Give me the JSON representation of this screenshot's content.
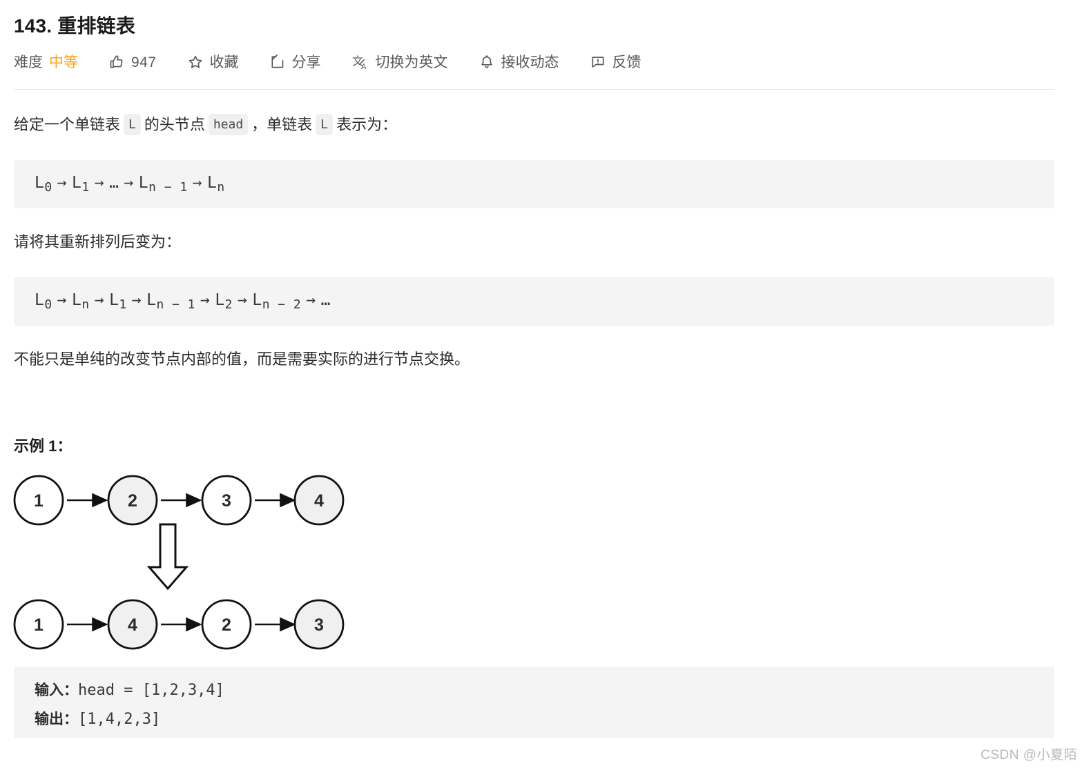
{
  "header": {
    "title": "143. 重排链表",
    "toolbar": {
      "difficulty_label": "难度",
      "difficulty_value": "中等",
      "difficulty_color": "#ffa116",
      "like_count": "947",
      "favorite_label": "收藏",
      "share_label": "分享",
      "translate_label": "切换为英文",
      "subscribe_label": "接收动态",
      "feedback_label": "反馈",
      "icons": {
        "like": "thumbs-up-icon",
        "favorite": "star-icon",
        "share": "share-box-icon",
        "translate": "translate-icon",
        "subscribe": "bell-icon",
        "feedback": "speech-bubble-alert-icon"
      }
    }
  },
  "content": {
    "paragraph_1": {
      "part_a": "给定一个单链表",
      "code_1": "L",
      "part_b": "的头节点",
      "code_2": "head",
      "part_c": "，单链表",
      "code_3": "L",
      "part_d": "表示为："
    },
    "formula_1": {
      "terms": [
        "L0",
        "Ln",
        "…",
        "Ln − 1",
        "Ln"
      ],
      "plain": "L0 → L1 → … → Ln − 1 → Ln"
    },
    "paragraph_2": "请将其重新排列后变为：",
    "formula_2": {
      "plain": "L0 → Ln → L1 → Ln − 1 → L2 → Ln − 2 → …"
    },
    "paragraph_3": "不能只是单纯的改变节点内部的值，而是需要实际的进行节点交换。",
    "example_heading": "示例 1："
  },
  "diagram": {
    "row_top": [
      {
        "value": "1",
        "fill": "#ffffff"
      },
      {
        "value": "2",
        "fill": "#f0f0f0"
      },
      {
        "value": "3",
        "fill": "#ffffff"
      },
      {
        "value": "4",
        "fill": "#f0f0f0"
      }
    ],
    "row_bottom": [
      {
        "value": "1",
        "fill": "#ffffff"
      },
      {
        "value": "4",
        "fill": "#f0f0f0"
      },
      {
        "value": "2",
        "fill": "#ffffff"
      },
      {
        "value": "3",
        "fill": "#f0f0f0"
      }
    ],
    "transform_arrow": "down-block-arrow-icon"
  },
  "example_io": {
    "input_label": "输入：",
    "input_value": "head = [1,2,3,4]",
    "output_label": "输出：",
    "output_value": "[1,4,2,3]"
  },
  "watermark": "CSDN @小夏陌"
}
